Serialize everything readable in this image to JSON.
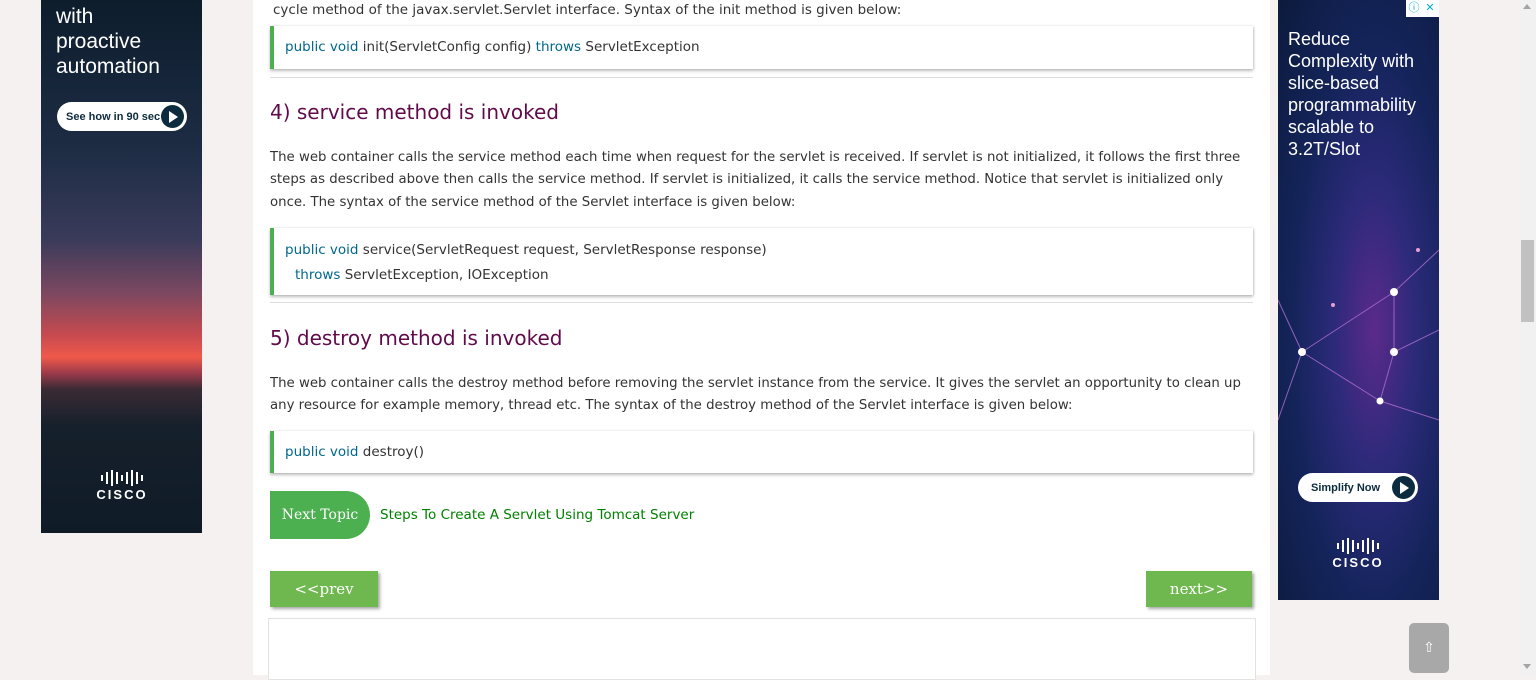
{
  "ad_left": {
    "lines": [
      "with",
      "proactive",
      "automation"
    ],
    "cta_label": "See how in 90 sec",
    "brand": "CISCO"
  },
  "content": {
    "intro_text": "cycle method of the javax.servlet.Servlet interface. Syntax of the init method is given below:",
    "code_init": {
      "kw1": "public void",
      "text1": "init(ServletConfig config)",
      "kw2": "throws",
      "text2": "ServletException"
    },
    "section4": {
      "heading": "4) service method is invoked",
      "paragraph_lines": [
        "The web container calls the service method each time when request for the servlet is received. If servlet is not initialized, it follows the first three",
        "steps as described above then calls the service method. If servlet is initialized, it calls the service method. Notice that servlet is initialized only",
        "once. The syntax of the service method of the Servlet interface is given below:"
      ],
      "code": {
        "kw1": "public void",
        "text1": "service(ServletRequest request, ServletResponse response)",
        "kw2": "throws",
        "text2": "ServletException, IOException"
      }
    },
    "section5": {
      "heading": "5) destroy method is invoked",
      "paragraph_lines": [
        "The web container calls the destroy method before removing the servlet instance from the service. It gives the servlet an opportunity to clean up",
        "any resource for example memory, thread etc. The syntax of the destroy method of the Servlet interface is given below:"
      ],
      "code": {
        "kw1": "public void",
        "text1": "destroy()"
      }
    },
    "next_topic_label": "Next Topic",
    "next_topic_link": "Steps To Create A Servlet Using Tomcat Server",
    "prev_button": "<<prev",
    "next_button": "next>>"
  },
  "ad_right": {
    "lines": [
      "Reduce",
      "Complexity with",
      "slice-based",
      "programmability",
      "scalable to",
      "3.2T/Slot"
    ],
    "cta_label": "Simplify Now",
    "brand": "CISCO",
    "adchoice_info": "ⓘ",
    "adchoice_close": "✕"
  },
  "scroll_top_label": "⇧",
  "colors": {
    "heading": "#610b4b",
    "code_keyword": "#00688b",
    "accent_green": "#4caf50",
    "link_green": "#008000"
  }
}
